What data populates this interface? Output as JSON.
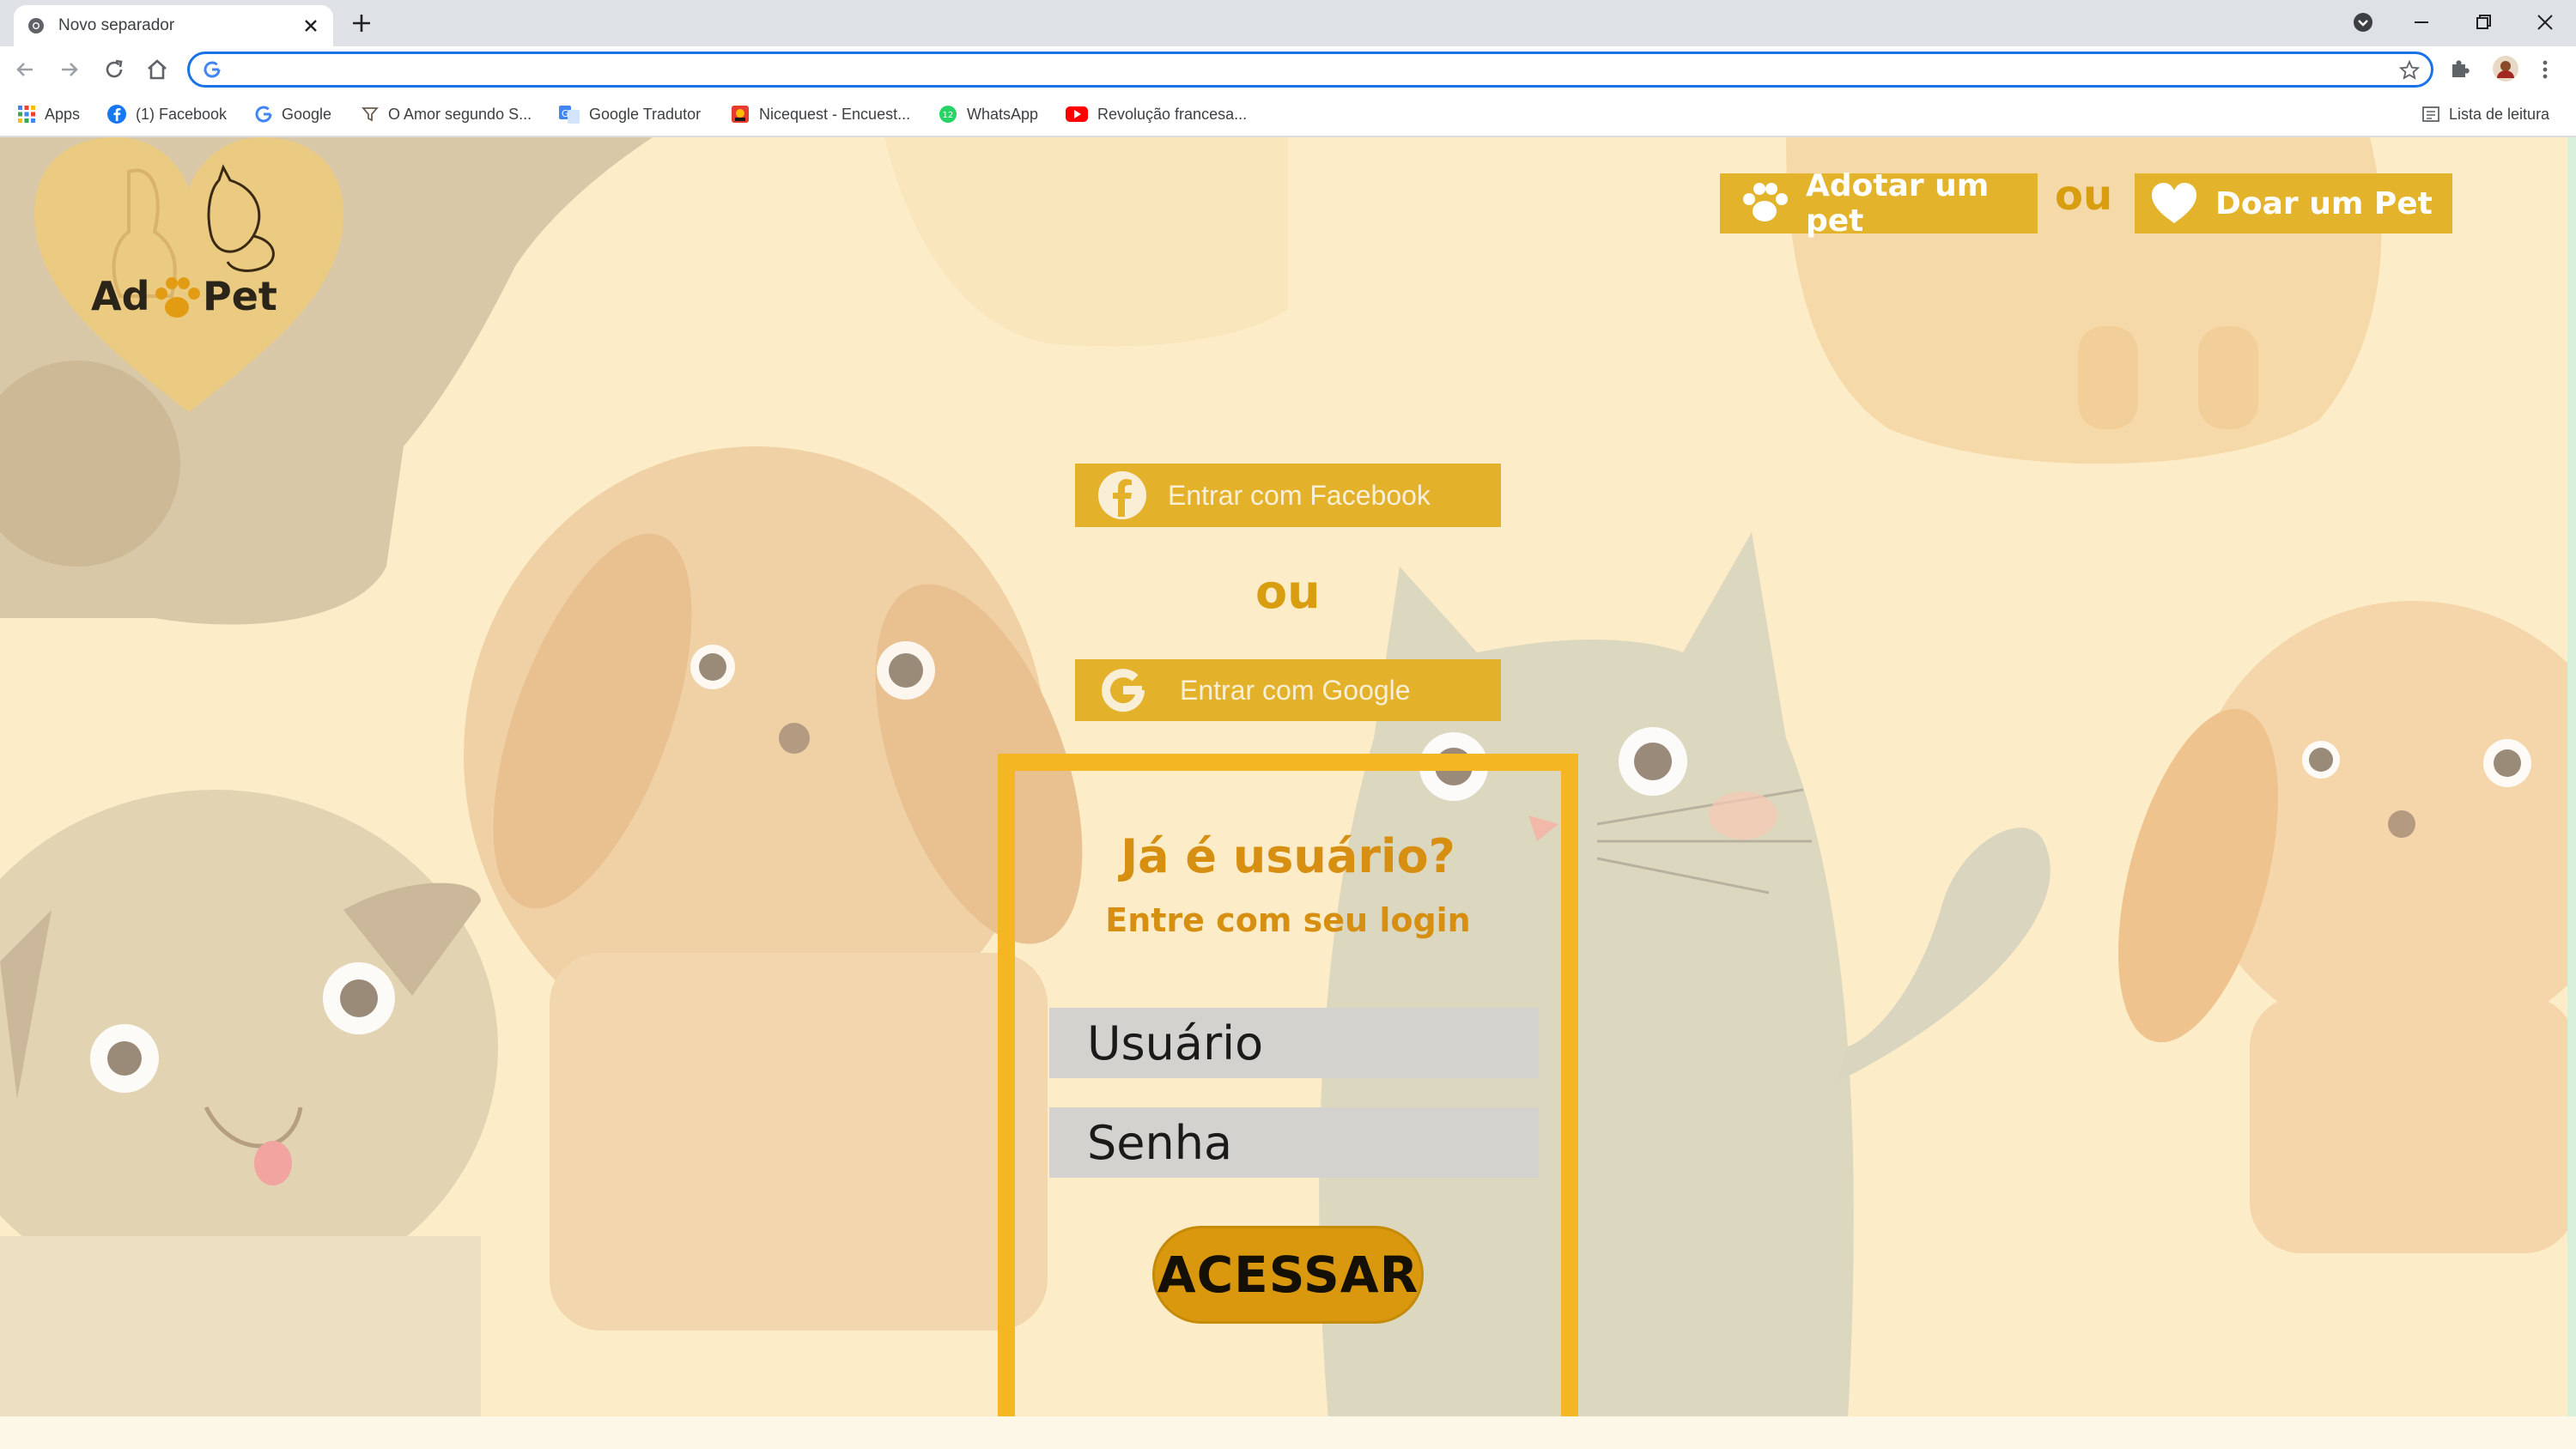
{
  "browser": {
    "tab_title": "Novo separador",
    "address_value": "",
    "bookmarks": [
      {
        "label": "Apps",
        "icon": "apps-grid-icon"
      },
      {
        "label": "(1) Facebook",
        "icon": "facebook-icon"
      },
      {
        "label": "Google",
        "icon": "google-icon"
      },
      {
        "label": "O Amor segundo S...",
        "icon": "filter-icon"
      },
      {
        "label": "Google Tradutor",
        "icon": "translate-icon"
      },
      {
        "label": "Nicequest - Encuest...",
        "icon": "nicequest-icon"
      },
      {
        "label": "WhatsApp",
        "icon": "whatsapp-icon"
      },
      {
        "label": "Revolução francesa...",
        "icon": "youtube-icon"
      }
    ],
    "reading_list_label": "Lista de leitura"
  },
  "header": {
    "logo_text_left": "Ad",
    "logo_text_right": "Pet",
    "adopt_button": "Adotar um pet",
    "or_separator": "ou",
    "donate_button": "Doar um Pet"
  },
  "social_login": {
    "facebook_button": "Entrar com Facebook",
    "or_separator": "ou",
    "google_button": "Entrar com Google"
  },
  "login": {
    "title": "Já é usuário?",
    "subtitle": "Entre com seu login",
    "username_placeholder": "Usuário",
    "password_placeholder": "Senha",
    "submit_label": "ACESSAR"
  },
  "colors": {
    "accent_yellow": "#e2b32b",
    "box_border": "#f4b622",
    "title_orange": "#d68f11",
    "submit_bg": "#d9980d",
    "page_bg": "#fcecc8"
  }
}
